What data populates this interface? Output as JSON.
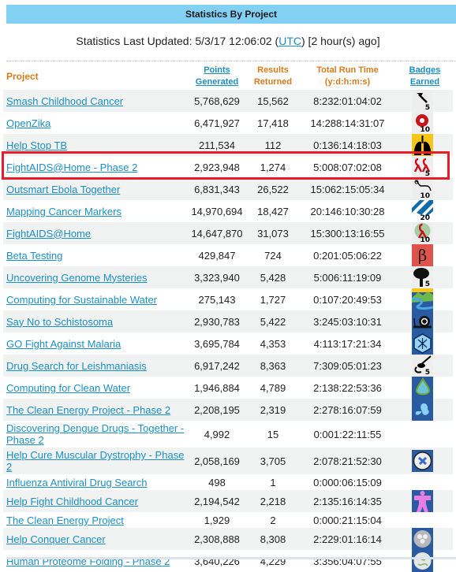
{
  "header": {
    "title": "Statistics By Project",
    "updated_prefix": "Statistics Last Updated: 5/3/17 12:06:02 (",
    "updated_link": "UTC",
    "updated_suffix": ") [2 hour(s) ago]"
  },
  "columns": {
    "project": "Project",
    "points_1": "Points",
    "points_2": "Generated",
    "results_1": "Results",
    "results_2": "Returned",
    "time_1": "Total Run Time",
    "time_2": "(y:d:h:m:s)",
    "badges_1": "Badges",
    "badges_2": "Earned"
  },
  "highlight_row": "FightAIDS@Home - Phase 2",
  "colors": {
    "header_bg": "#83d0f5",
    "link": "#1a8fc6",
    "column_header": "#d97a1a",
    "highlight": "#e61e2a"
  },
  "rows": [
    {
      "name": "Smash Childhood Cancer",
      "points": "5,768,629",
      "results": "15,562",
      "time": "8:232:01:04:02",
      "badge": "hammer-icon",
      "badge_num": "5"
    },
    {
      "name": "OpenZika",
      "points": "6,471,927",
      "results": "17,418",
      "time": "14:288:14:31:07",
      "badge": "virus-icon",
      "badge_num": "10"
    },
    {
      "name": "Help Stop TB",
      "points": "211,534",
      "results": "112",
      "time": "0:136:14:18:03",
      "badge": "lungs-icon",
      "badge_num": ""
    },
    {
      "name": "FightAIDS@Home - Phase 2",
      "points": "2,923,948",
      "results": "1,274",
      "time": "5:008:07:02:08",
      "badge": "ribbons-icon",
      "badge_num": "5"
    },
    {
      "name": "Outsmart Ebola Together",
      "points": "6,831,343",
      "results": "26,522",
      "time": "15:062:15:05:34",
      "badge": "ebola-icon",
      "badge_num": "10"
    },
    {
      "name": "Mapping Cancer Markers",
      "points": "14,970,694",
      "results": "18,427",
      "time": "20:146:10:30:28",
      "badge": "markers-icon",
      "badge_num": "20"
    },
    {
      "name": "FightAIDS@Home",
      "points": "14,647,870",
      "results": "31,073",
      "time": "15:300:13:16:55",
      "badge": "ribbon-icon",
      "badge_num": "10"
    },
    {
      "name": "Beta Testing",
      "points": "429,847",
      "results": "724",
      "time": "0:201:05:06:22",
      "badge": "beta-icon",
      "badge_num": ""
    },
    {
      "name": "Uncovering Genome Mysteries",
      "points": "3,323,940",
      "results": "5,428",
      "time": "5:006:11:19:09",
      "badge": "tree-icon",
      "badge_num": "5"
    },
    {
      "name": "Computing for Sustainable Water",
      "points": "275,143",
      "results": "1,727",
      "time": "0:107:20:49:53",
      "badge": "river-icon",
      "badge_num": ""
    },
    {
      "name": "Say No to Schistosoma",
      "points": "2,930,783",
      "results": "5,422",
      "time": "3:245:03:10:31",
      "badge": "snail-icon",
      "badge_num": ""
    },
    {
      "name": "GO Fight Against Malaria",
      "points": "3,695,784",
      "results": "4,353",
      "time": "4:113:17:21:34",
      "badge": "mosquito-icon",
      "badge_num": ""
    },
    {
      "name": "Drug Search for Leishmaniasis",
      "points": "6,917,242",
      "results": "8,363",
      "time": "7:309:05:01:23",
      "badge": "sandfly-icon",
      "badge_num": "5"
    },
    {
      "name": "Computing for Clean Water",
      "points": "1,946,884",
      "results": "4,789",
      "time": "2:138:22:53:36",
      "badge": "water-drop-icon",
      "badge_num": ""
    },
    {
      "name": "The Clean Energy Project - Phase 2",
      "points": "2,208,195",
      "results": "2,319",
      "time": "2:278:16:07:59",
      "badge": "butterfly-icon",
      "badge_num": ""
    },
    {
      "name": "Discovering Dengue Drugs - Together - Phase 2",
      "points": "4,992",
      "results": "15",
      "time": "0:001:22:11:55",
      "badge": "",
      "badge_num": ""
    },
    {
      "name": "Help Cure Muscular Dystrophy - Phase 2",
      "points": "2,058,169",
      "results": "3,705",
      "time": "2:078:21:52:30",
      "badge": "dystrophy-icon",
      "badge_num": ""
    },
    {
      "name": "Influenza Antiviral Drug Search",
      "points": "498",
      "results": "1",
      "time": "0:000:06:15:09",
      "badge": "",
      "badge_num": ""
    },
    {
      "name": "Help Fight Childhood Cancer",
      "points": "2,194,542",
      "results": "2,218",
      "time": "2:135:16:14:35",
      "badge": "child-figure-icon",
      "badge_num": ""
    },
    {
      "name": "The Clean Energy Project",
      "points": "1,929",
      "results": "2",
      "time": "0:000:21:15:04",
      "badge": "",
      "badge_num": ""
    },
    {
      "name": "Help Conquer Cancer",
      "points": "2,308,888",
      "results": "8,308",
      "time": "2:229:01:16:14",
      "badge": "crystal-icon",
      "badge_num": ""
    },
    {
      "name": "Human Proteome Folding - Phase 2",
      "points": "3,640,226",
      "results": "4,229",
      "time": "3:356:04:07:55",
      "badge": "protein-icon",
      "badge_num": ""
    }
  ]
}
